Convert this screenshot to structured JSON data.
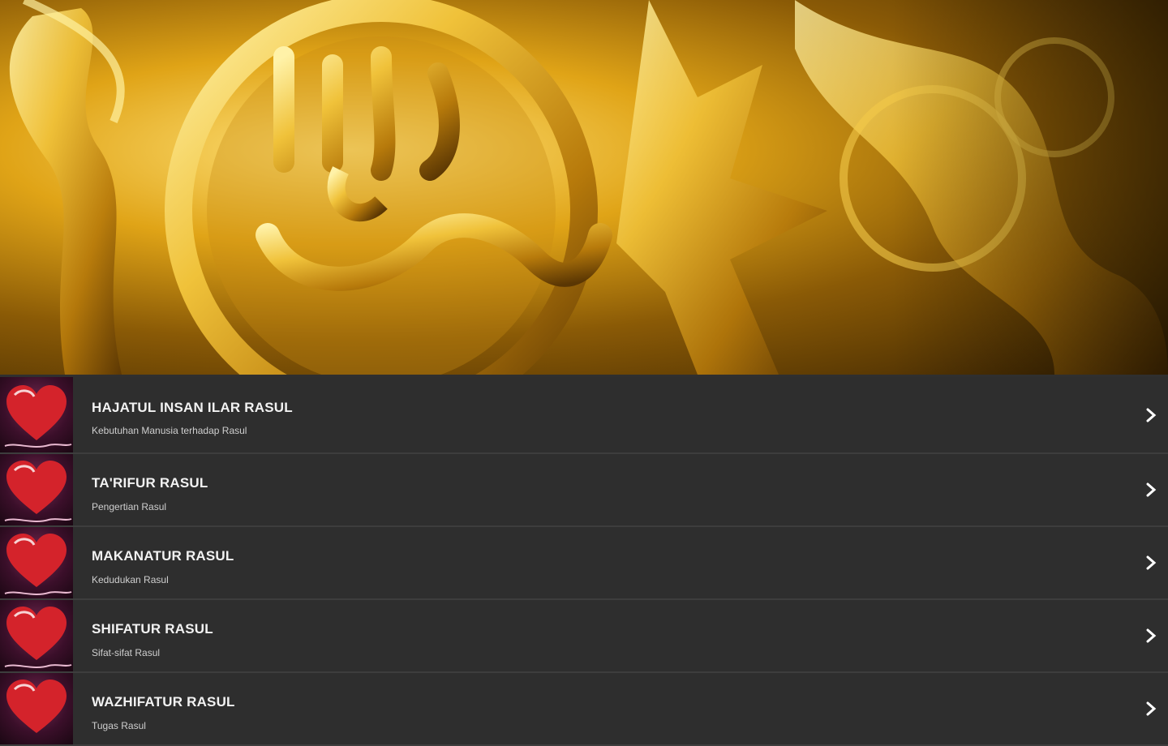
{
  "banner": {
    "image": "golden arabic calligraphy",
    "accent": "#d9a21b"
  },
  "items": [
    {
      "title": "HAJATUL INSAN ILAR RASUL",
      "subtitle": "Kebutuhan Manusia terhadap Rasul"
    },
    {
      "title": "TA'RIFUR RASUL",
      "subtitle": "Pengertian Rasul"
    },
    {
      "title": "MAKANATUR RASUL",
      "subtitle": "Kedudukan Rasul"
    },
    {
      "title": "SHIFATUR RASUL",
      "subtitle": "Sifat-sifat Rasul"
    },
    {
      "title": "WAZHIFATUR RASUL",
      "subtitle": "Tugas Rasul"
    }
  ],
  "icons": {
    "thumb": "heart-icon",
    "chevron": "chevron-right-icon"
  }
}
